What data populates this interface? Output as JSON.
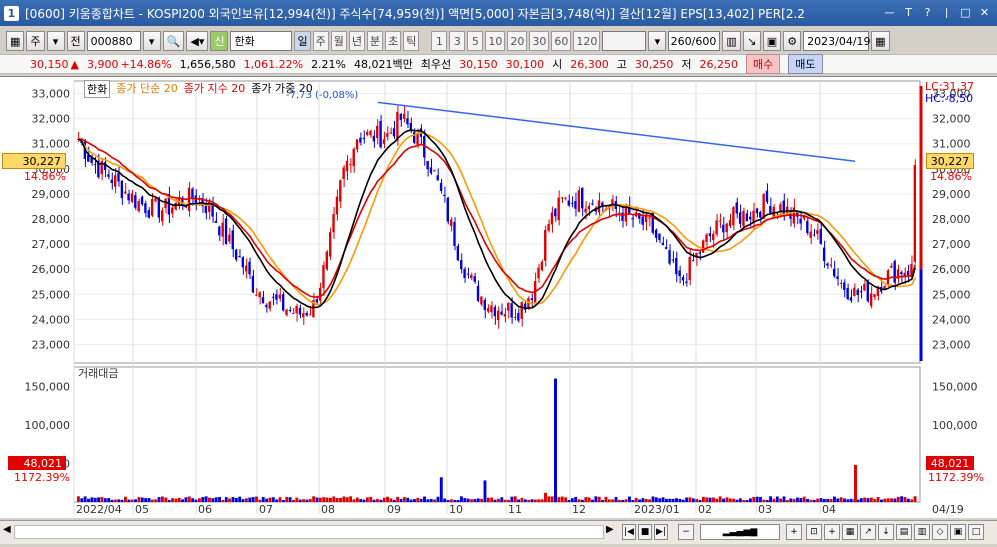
{
  "window": {
    "title": "[0600] 키움종합차트 - KOSPI200 외국인보유[12,994(천)] 주식수[74,959(천)] 액면[5,000] 자본금[3,748(억)] 결산[12월] EPS[13,402] PER[2.2",
    "app_icon": "1",
    "buttons": [
      "ㅡ",
      "T",
      "?",
      "ㅣ",
      "□",
      "✕"
    ]
  },
  "toolbar": {
    "type_label": "주",
    "all_label": "전",
    "code": "000880",
    "stock_name": "한화",
    "credit_badge": "신",
    "period_tabs": [
      "일",
      "주",
      "월",
      "년",
      "분",
      "초",
      "틱"
    ],
    "active_period": "일",
    "intervals": [
      "1",
      "3",
      "5",
      "10",
      "20",
      "30",
      "60",
      "120"
    ],
    "count": "260/600",
    "date": "2023/04/19"
  },
  "quote": {
    "price": "30,150",
    "change_arrow": "▲",
    "change": "3,900",
    "change_pct": "+14.86%",
    "volume": "1,656,580",
    "volume_ratio": "1,061.22%",
    "turnover": "2.21%",
    "amount": "48,021백만",
    "best_ask_label": "최우선",
    "best_ask": "30,150",
    "best_bid": "30,100",
    "open_label": "시",
    "open": "26,300",
    "high_label": "고",
    "high": "30,250",
    "low_label": "저",
    "low": "26,250",
    "buy_label": "매수",
    "sell_label": "매도"
  },
  "legend": {
    "stock": "한화",
    "ma1": "종가 단순 20",
    "ma2": "종가 지수 20",
    "ma3": "종가 가중 20"
  },
  "overlay": {
    "left_price": "30,227",
    "left_pct": "14.86%",
    "right_price": "30,227",
    "right_pct": "14.86%",
    "lc": "LC:31,37",
    "hc": "HC:-8,50",
    "trendline": "-7,73 (-0,08%)"
  },
  "volume_panel": {
    "title": "거래대금",
    "left_value": "48,021",
    "left_pct": "1172.39%",
    "right_value": "48,021",
    "right_pct": "1172.39%"
  },
  "colors": {
    "up": "#e00000",
    "down": "#0000e0",
    "ma_simple": "#ff9900",
    "ma_exp": "#e00000",
    "ma_weighted": "#000000",
    "trend": "#3366ee"
  },
  "chart_data": {
    "type": "candlestick",
    "price_axis_ticks": [
      "33,000",
      "32,000",
      "31,000",
      "30,000",
      "29,000",
      "28,000",
      "27,000",
      "26,000",
      "25,000",
      "24,000",
      "23,000"
    ],
    "volume_axis_ticks": [
      "150,000",
      "100,000",
      "50,000"
    ],
    "x_labels": [
      "2022/04",
      "05",
      "06",
      "07",
      "08",
      "09",
      "10",
      "11",
      "12",
      "2023/01",
      "02",
      "03",
      "04"
    ],
    "end_date_label": "04/19",
    "ylim": [
      22500,
      33500
    ],
    "close_path": [
      31200,
      30200,
      29800,
      29200,
      28700,
      28400,
      28400,
      28700,
      28900,
      28400,
      27300,
      26400,
      25300,
      24800,
      24500,
      24200,
      24500,
      26500,
      29800,
      31300,
      31300,
      31300,
      32000,
      31300,
      30200,
      28500,
      26500,
      25200,
      24600,
      24400,
      24400,
      25200,
      27800,
      28700,
      28800,
      28800,
      28500,
      28300,
      27900,
      27700,
      26500,
      25400,
      26400,
      27300,
      27900,
      28100,
      28300,
      28700,
      28400,
      28000,
      27600,
      26500,
      25400,
      25000,
      25100,
      25700,
      26000,
      26000,
      30150
    ],
    "volume_spike_value": 160000,
    "last_volume": 48021
  }
}
